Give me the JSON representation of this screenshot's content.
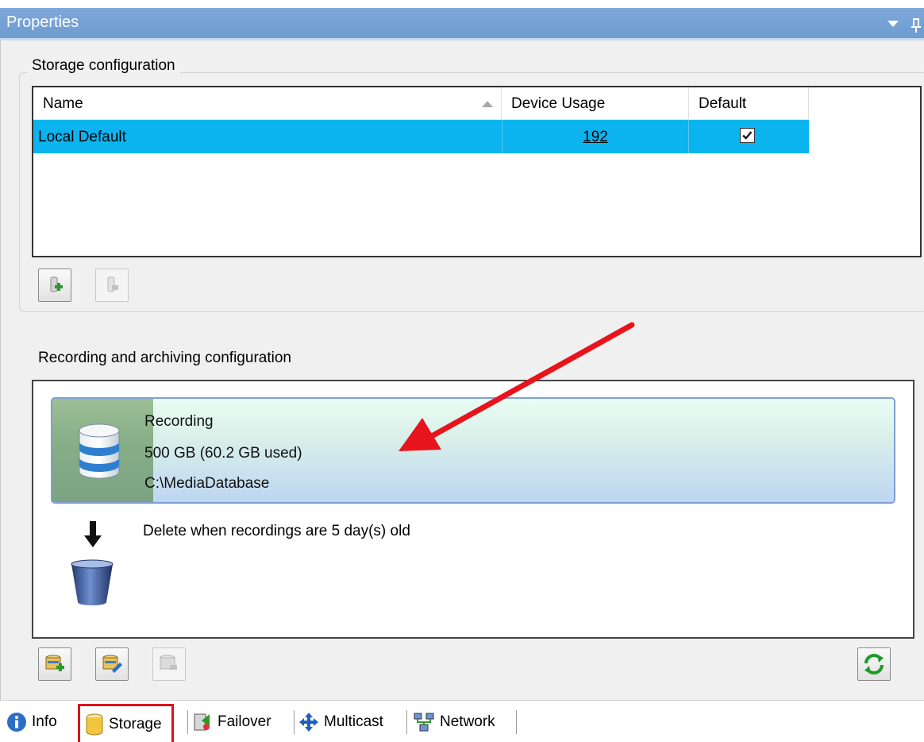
{
  "window": {
    "title": "Properties"
  },
  "storage_config": {
    "group_label": "Storage configuration",
    "columns": [
      "Name",
      "Device Usage",
      "Default"
    ],
    "rows": [
      {
        "name": "Local Default",
        "device_usage": "192",
        "default": true
      }
    ]
  },
  "recording": {
    "group_label": "Recording and archiving configuration",
    "title": "Recording",
    "size": "500 GB (60.2 GB used)",
    "path": "C:\\MediaDatabase",
    "usage_fraction": 0.12,
    "delete_rule": "Delete when recordings are 5 day(s) old"
  },
  "tabs": [
    {
      "label": "Info",
      "icon": "info-icon",
      "active": false
    },
    {
      "label": "Storage",
      "icon": "database-icon",
      "active": true
    },
    {
      "label": "Failover",
      "icon": "failover-icon",
      "active": false
    },
    {
      "label": "Multicast",
      "icon": "multicast-icon",
      "active": false
    },
    {
      "label": "Network",
      "icon": "network-icon",
      "active": false
    }
  ],
  "colors": {
    "title_bar": "#6e9bd1",
    "selection": "#0bb4ef",
    "annotation": "#e8141c"
  }
}
